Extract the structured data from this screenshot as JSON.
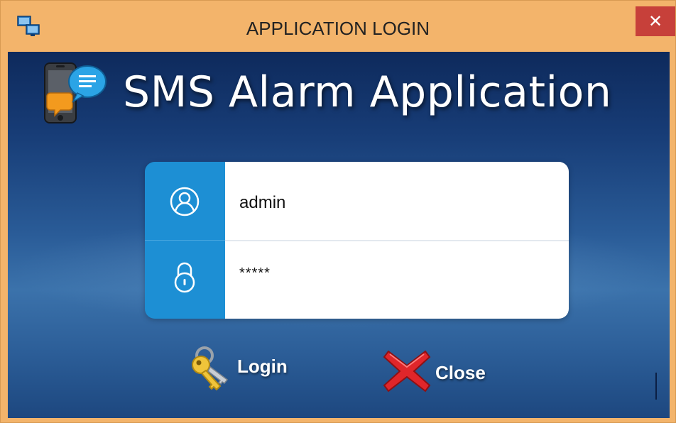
{
  "window": {
    "title": "APPLICATION LOGIN",
    "close_glyph": "✕",
    "app_icon": "network-computers-icon"
  },
  "header": {
    "logo_icon": "phone-chat-bubbles-icon",
    "app_title": "SMS Alarm Application"
  },
  "login_form": {
    "username": {
      "icon": "user-icon",
      "value": "admin"
    },
    "password": {
      "icon": "lock-icon",
      "value": "*****"
    }
  },
  "buttons": {
    "login": {
      "label": "Login",
      "icon": "keys-icon"
    },
    "close": {
      "label": "Close",
      "icon": "red-x-icon"
    }
  },
  "colors": {
    "titlebar": "#f3b46b",
    "close_button": "#c7403a",
    "panel_accent": "#1d8fd4",
    "background_dark": "#0e2a5c",
    "background_light": "#3b72ab"
  }
}
